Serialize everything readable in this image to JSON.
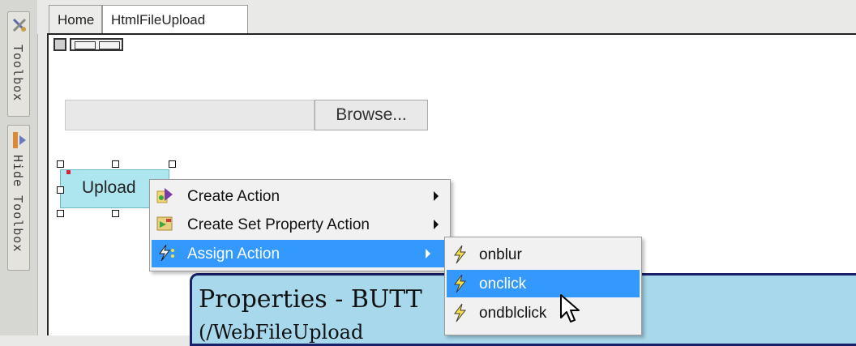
{
  "side_toolbar": {
    "toolbox_label": "Toolbox",
    "hide_toolbox_label": "Hide Toolbox"
  },
  "tabs": [
    {
      "label": "Home",
      "active": false
    },
    {
      "label": "HtmlFileUpload",
      "active": true
    }
  ],
  "canvas": {
    "browse_label": "Browse...",
    "upload_label": "Upload",
    "properties_title": "Properties - BUTT",
    "properties_line2": "(/WebFileUpload"
  },
  "context_menu": {
    "items": [
      {
        "label": "Create Action",
        "icon": "create-action-icon",
        "has_submenu": true
      },
      {
        "label": "Create Set Property Action",
        "icon": "set-property-icon",
        "has_submenu": true
      },
      {
        "label": "Assign Action",
        "icon": "lightning-icon",
        "has_submenu": true,
        "selected": true
      }
    ]
  },
  "submenu": {
    "items": [
      {
        "label": "onblur",
        "icon": "lightning-icon"
      },
      {
        "label": "onclick",
        "icon": "lightning-icon",
        "selected": true
      },
      {
        "label": "ondblclick",
        "icon": "lightning-icon"
      }
    ]
  },
  "colors": {
    "selection": "#3399ff",
    "upload_button": "#aee6f0",
    "properties_panel": "#a8d8ec",
    "panel_border": "#18206a"
  }
}
